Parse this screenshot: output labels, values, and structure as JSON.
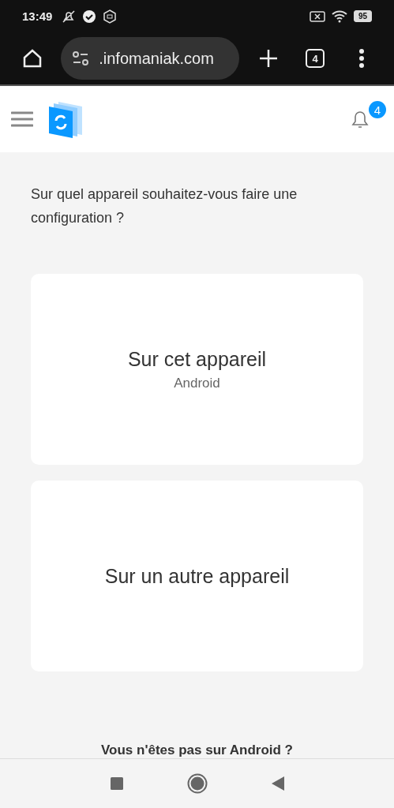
{
  "status_bar": {
    "time": "13:49",
    "battery": "95"
  },
  "browser": {
    "url": ".infomaniak.com",
    "tab_count": "4"
  },
  "header": {
    "notification_count": "4"
  },
  "question": "Sur quel appareil souhaitez-vous faire une configuration ?",
  "options": [
    {
      "title": "Sur cet appareil",
      "subtitle": "Android"
    },
    {
      "title": "Sur un autre appareil"
    }
  ],
  "footer_text": "Vous n'êtes pas sur Android ?"
}
